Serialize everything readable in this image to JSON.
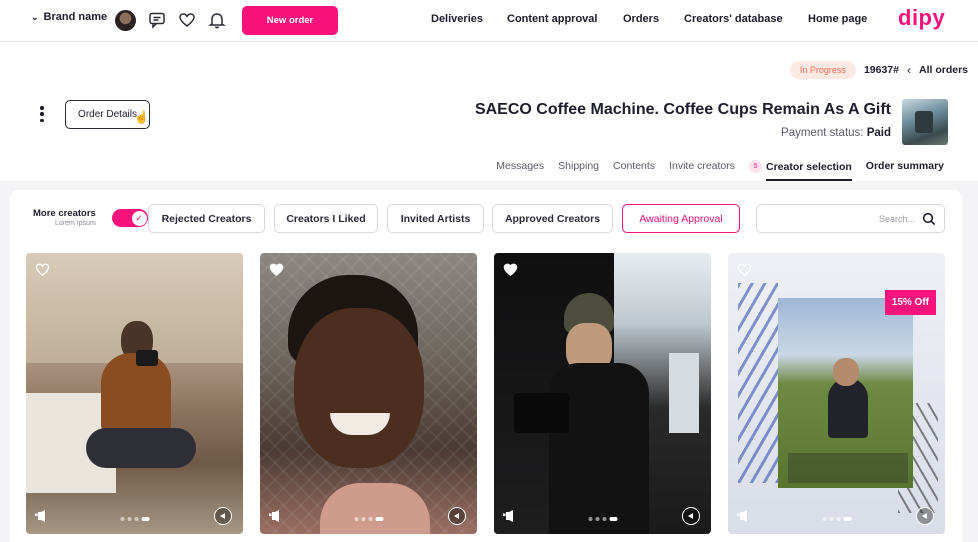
{
  "nav": {
    "brand_label": "Brand name",
    "new_order_label": "New order",
    "links": [
      "Deliveries",
      "Content approval",
      "Orders",
      "Creators' database",
      "Home page"
    ],
    "logo": "dipy",
    "icons": [
      "chevron-down-icon",
      "avatar",
      "chat-icon",
      "heart-icon",
      "bell-icon"
    ]
  },
  "header": {
    "status": "In Progress",
    "order_number": "19637#",
    "back_label": "All orders",
    "order_details_label": "Order Details",
    "title": "SAECO Coffee Machine. Coffee Cups Remain As A Gift",
    "payment_label": "Payment status:",
    "payment_value": "Paid",
    "tabs": [
      "Messages",
      "Shipping",
      "Contents",
      "Invite creators",
      "Creator selection",
      "Order summary"
    ],
    "active_tab": "Creator selection",
    "creator_selection_count": "5"
  },
  "filters": {
    "more_creators_label": "More creators",
    "more_creators_sub": "Lorem Ipsum",
    "toggle_on": true,
    "buttons": [
      "Rejected Creators",
      "Creators I Liked",
      "Invited Artists",
      "Approved Creators",
      "Awaiting Approval"
    ],
    "active": "Awaiting Approval",
    "search_placeholder": "Search..."
  },
  "cards": [
    {
      "liked": false,
      "discount": ""
    },
    {
      "liked": true,
      "discount": ""
    },
    {
      "liked": true,
      "discount": ""
    },
    {
      "liked": false,
      "discount": "15% Off"
    }
  ],
  "colors": {
    "accent": "#f7127c",
    "status_bg": "#fde9e4",
    "status_text": "#ef6a52"
  }
}
